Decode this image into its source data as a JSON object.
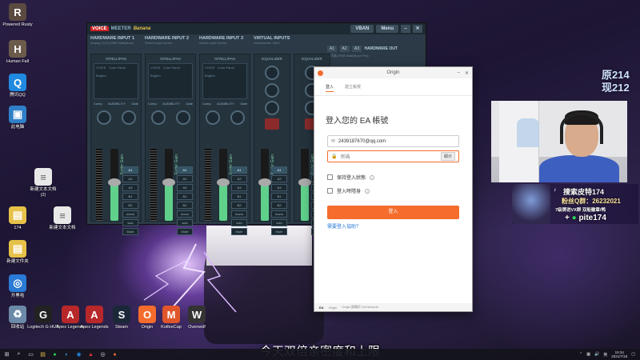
{
  "desktop_icons": [
    {
      "label": "Powered Rusty",
      "glyph": "R",
      "color": "#5a4a40"
    },
    {
      "label": "Human Fall",
      "glyph": "H",
      "color": "#6b5b4b"
    },
    {
      "label": "腾讯QQ",
      "glyph": "Q",
      "color": "#1f8ae0"
    },
    {
      "label": "此电脑",
      "glyph": "▣",
      "color": "#2f80c8"
    },
    {
      "label": "新建文本文档 (2)",
      "glyph": "≡",
      "color": "#e8e8e8"
    },
    {
      "label": "174",
      "glyph": "▤",
      "color": "#e6c24a"
    },
    {
      "label": "新建文本文档",
      "glyph": "≡",
      "color": "#e8e8e8"
    },
    {
      "label": "新建文件夹",
      "glyph": "▤",
      "color": "#e6c24a"
    },
    {
      "label": "开黑啦",
      "glyph": "◎",
      "color": "#2a7ad6"
    },
    {
      "label": "回收站",
      "glyph": "♻",
      "color": "#6c8aa8"
    },
    {
      "label": "Logitech G HUB",
      "glyph": "G",
      "color": "#222"
    },
    {
      "label": "Apex Legends",
      "glyph": "A",
      "color": "#b8282a"
    },
    {
      "label": "Apex Legends",
      "glyph": "A",
      "color": "#b8282a"
    },
    {
      "label": "Steam",
      "glyph": "S",
      "color": "#1b2838"
    },
    {
      "label": "Origin",
      "glyph": "O",
      "color": "#f56c2d"
    },
    {
      "label": "KoifeeCap",
      "glyph": "M",
      "color": "#e0562a"
    },
    {
      "label": "Overwolf",
      "glyph": "W",
      "color": "#333"
    }
  ],
  "voicemeeter": {
    "brand_v": "VOICE",
    "brand_meeter": "MEETER",
    "brand_banana": "Banana",
    "vban": "VBAN",
    "menu": "Menu",
    "strips": [
      {
        "title": "HARDWARE INPUT 1",
        "sub": "Analog (Yv2) (PME Blab)Nuce",
        "intelli": "INTELLIPAN",
        "voice": "VOICE",
        "color_panel": "Color Panel",
        "brightness": "Brightn",
        "comp": "Comp",
        "audibility": "AUDIBILITY",
        "gate": "Gate",
        "fader": "Fader Gain",
        "gain": "0dB"
      },
      {
        "title": "HARDWARE INPUT 2",
        "sub": "Select Input Device",
        "intelli": "INTELLIPAN",
        "voice": "VOICE",
        "color_panel": "Color Panel",
        "brightness": "Brightn",
        "comp": "Comp",
        "audibility": "AUDIBILITY",
        "gate": "Gate",
        "fader": "Fader Gain",
        "gain": "0dB"
      },
      {
        "title": "HARDWARE INPUT 3",
        "sub": "Select Input Device",
        "intelli": "INTELLIPAN",
        "voice": "VOICE",
        "color_panel": "Color Panel",
        "brightness": "Brightn",
        "comp": "Comp",
        "audibility": "AUDIBILITY",
        "gate": "Gate",
        "fader": "Fader Gain",
        "gain": "0dB"
      }
    ],
    "virtual": [
      {
        "title": "VIRTUAL INPUTS",
        "sub": "Voicemeeter VAIO",
        "eq": "EQUALIZER",
        "fader": "Fader Gain",
        "gain": "0dB"
      },
      {
        "title": "",
        "sub": "Voicemeeter AUX",
        "eq": "EQUALIZER",
        "fader": "Fader Gain",
        "gain": "0dB"
      }
    ],
    "bus_buttons": [
      "A1",
      "A2",
      "A3",
      "B1",
      "B2",
      "mono",
      "solo",
      "Mute"
    ],
    "hw_out": "HARDWARE OUT",
    "hw_out_sub": "扬声器 (PME Blab)Nuce Pro)",
    "ab": [
      "A1",
      "A2",
      "A3"
    ],
    "select_file": "Click to Select Audio file for Playback"
  },
  "origin": {
    "title": "Origin",
    "tabs": [
      "登入",
      "建立帳號"
    ],
    "heading": "登入您的 EA 帳號",
    "email_value": "2439187670@qq.com",
    "password_placeholder": "密碼",
    "show_label": "顯示",
    "remember_label": "保持登入狀態",
    "invisible_label": "登入時隱身",
    "login_button": "登入",
    "help_link": "需要登入協助？",
    "footer_ea": "EA",
    "footer_origin": "Origin",
    "footer_network": "Origin 隸屬於 EA Network"
  },
  "overlay": {
    "counter_line1": "原214",
    "counter_line2": "现212",
    "promo_search": "搜索皮特174",
    "promo_fans": "粉丝Q群：26232021",
    "promo_levels": "7级牌进VX群 双船徽章/鸭",
    "promo_vx": "pite174"
  },
  "subtitle": "今天双倍亲密度和上限",
  "taskbar": {
    "ime": "英",
    "clock_time": "15:34",
    "clock_date": "2021/7/18"
  }
}
